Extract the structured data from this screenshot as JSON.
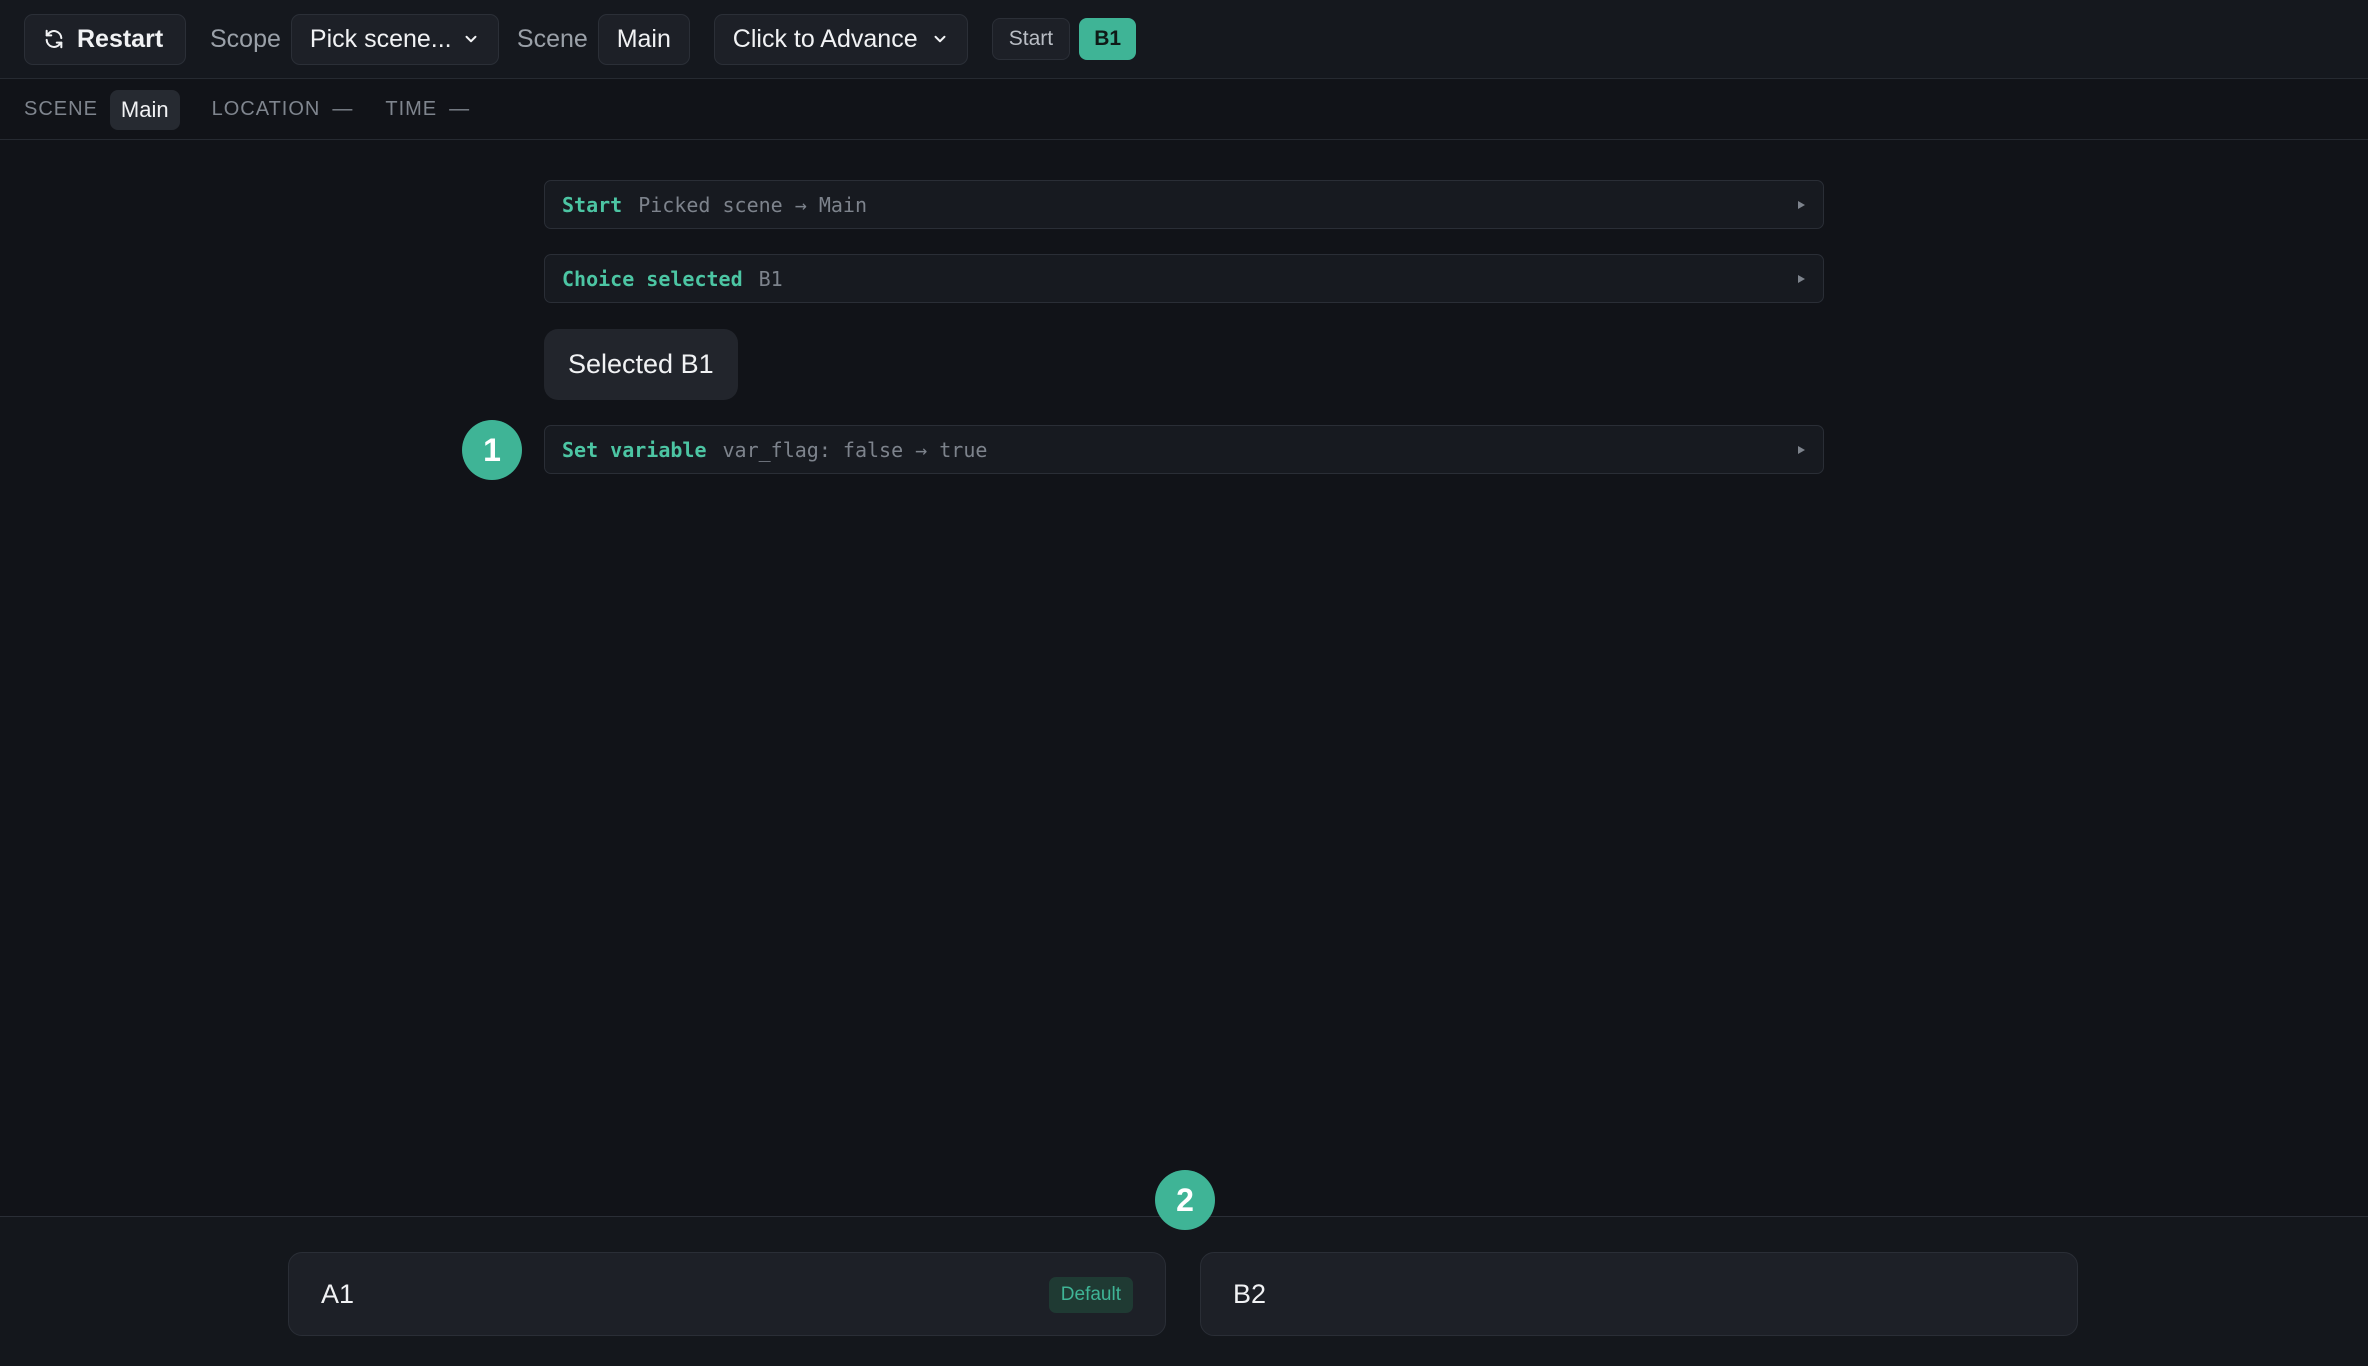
{
  "toolbar": {
    "restart_label": "Restart",
    "scope_label": "Scope",
    "scope_select_value": "Pick scene...",
    "scene_label": "Scene",
    "scene_value": "Main",
    "advance_mode": "Click to Advance",
    "history": [
      "Start",
      "B1"
    ]
  },
  "info": {
    "scene_key": "SCENE",
    "scene_value": "Main",
    "location_key": "LOCATION",
    "location_value": "—",
    "time_key": "TIME",
    "time_value": "—"
  },
  "log": [
    {
      "key": "Start",
      "value": "Picked scene → Main"
    },
    {
      "key": "Choice selected",
      "value": "B1"
    },
    {
      "key": "Set variable",
      "value": "var_flag: false → true"
    }
  ],
  "bubble": {
    "text": "Selected B1"
  },
  "markers": {
    "first": "1",
    "second": "2"
  },
  "choices": [
    {
      "label": "A1",
      "badge": "Default"
    },
    {
      "label": "B2"
    }
  ],
  "colors": {
    "accent": "#3fb496",
    "background": "#111318"
  }
}
